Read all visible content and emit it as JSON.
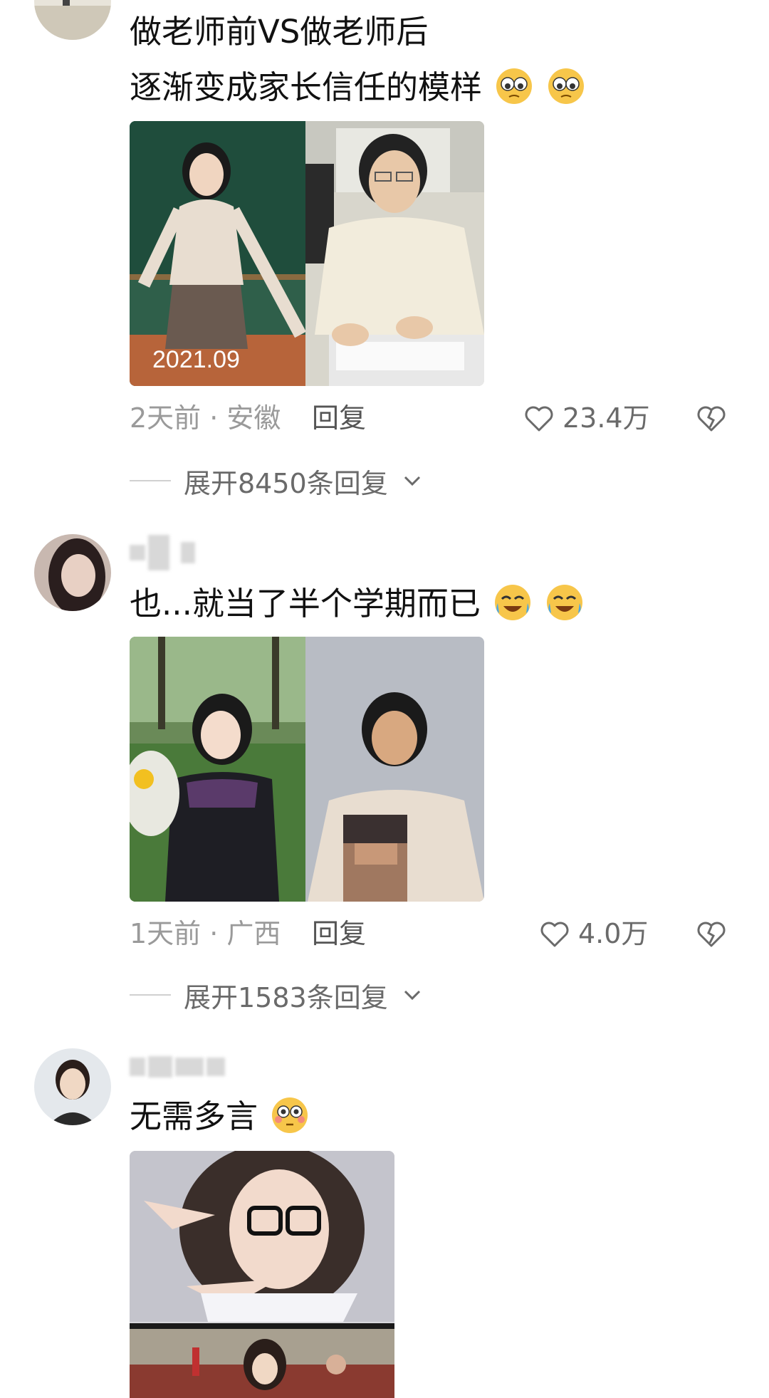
{
  "comments": [
    {
      "lines": [
        "做老师前VS做老师后",
        "逐渐变成家长信任的模样"
      ],
      "photo_caption": "2021.09",
      "time_location": "2天前 · 安徽",
      "reply_label": "回复",
      "likes": "23.4万",
      "expand_label": "展开8450条回复"
    },
    {
      "lines": [
        "也...就当了半个学期而已"
      ],
      "time_location": "1天前 · 广西",
      "reply_label": "回复",
      "likes": "4.0万",
      "expand_label": "展开1583条回复"
    },
    {
      "lines": [
        "无需多言"
      ]
    }
  ],
  "icons": {
    "like": "heart-outline-icon",
    "dislike": "broken-heart-icon",
    "expand": "chevron-down-icon",
    "emoji_1": "pleading-eyes-emoji",
    "emoji_2": "tears-of-joy-emoji",
    "emoji_3": "flushed-emoji"
  },
  "colors": {
    "text": "#111111",
    "meta": "#9a9a9a",
    "emoji_yellow": "#f7c64a"
  }
}
